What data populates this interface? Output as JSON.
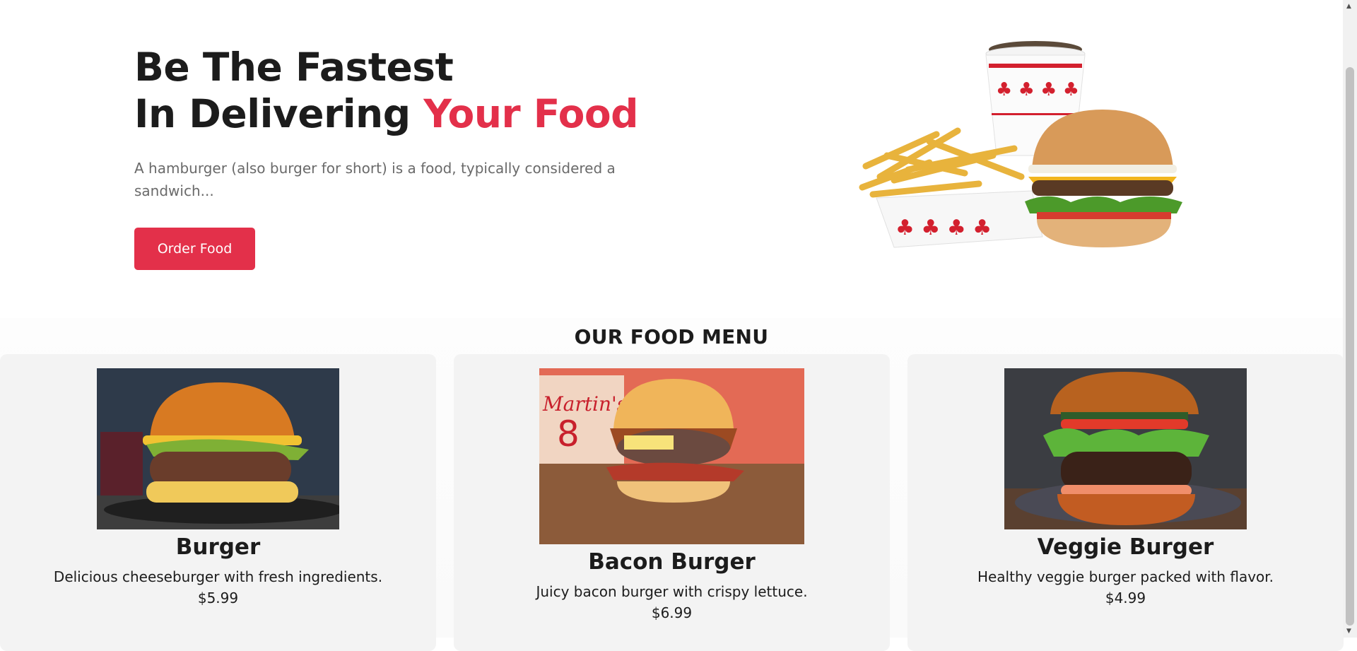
{
  "hero": {
    "title_line1": "Be The Fastest",
    "title_line2": "In Delivering",
    "title_accent": "Your Food",
    "description": "A hamburger (also burger for short) is a food, typically considered a sandwich...",
    "button_label": "Order Food"
  },
  "menu": {
    "heading": "OUR FOOD MENU",
    "items": [
      {
        "name": "Burger",
        "description": "Delicious cheeseburger with fresh ingredients.",
        "price": "$5.99"
      },
      {
        "name": "Bacon Burger",
        "description": "Juicy bacon burger with crispy lettuce.",
        "price": "$6.99"
      },
      {
        "name": "Veggie Burger",
        "description": "Healthy veggie burger packed with flavor.",
        "price": "$4.99"
      }
    ]
  },
  "colors": {
    "accent": "#e3304a",
    "text": "#1c1c1c",
    "muted": "#6a6a6a",
    "card_bg": "#f3f3f3"
  },
  "icons": {
    "scroll_up": "triangle-up-icon",
    "scroll_down": "triangle-down-icon"
  }
}
